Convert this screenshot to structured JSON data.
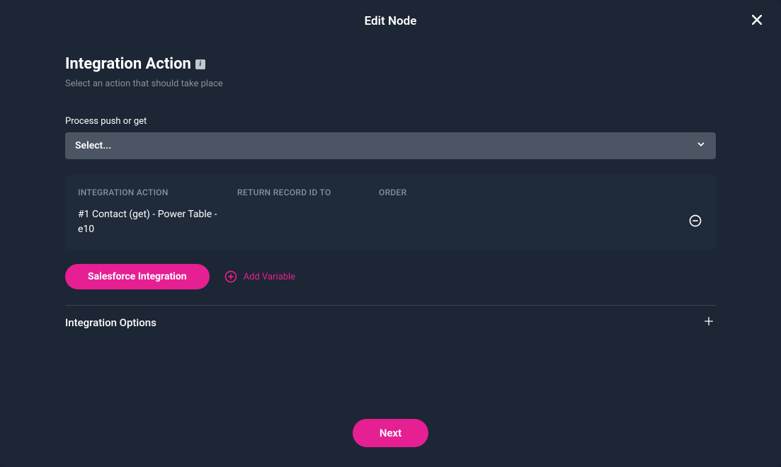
{
  "modal": {
    "title": "Edit Node"
  },
  "section": {
    "title": "Integration Action",
    "subtitle": "Select an action that should take place"
  },
  "field": {
    "label": "Process push or get",
    "select_placeholder": "Select..."
  },
  "table": {
    "headers": {
      "col1": "INTEGRATION ACTION",
      "col2": "RETURN RECORD ID TO",
      "col3": "ORDER"
    },
    "rows": [
      {
        "action": "#1 Contact (get) - Power Table - e10"
      }
    ]
  },
  "buttons": {
    "integration": "Salesforce Integration",
    "add_variable": "Add Variable",
    "next": "Next"
  },
  "options": {
    "label": "Integration Options"
  }
}
